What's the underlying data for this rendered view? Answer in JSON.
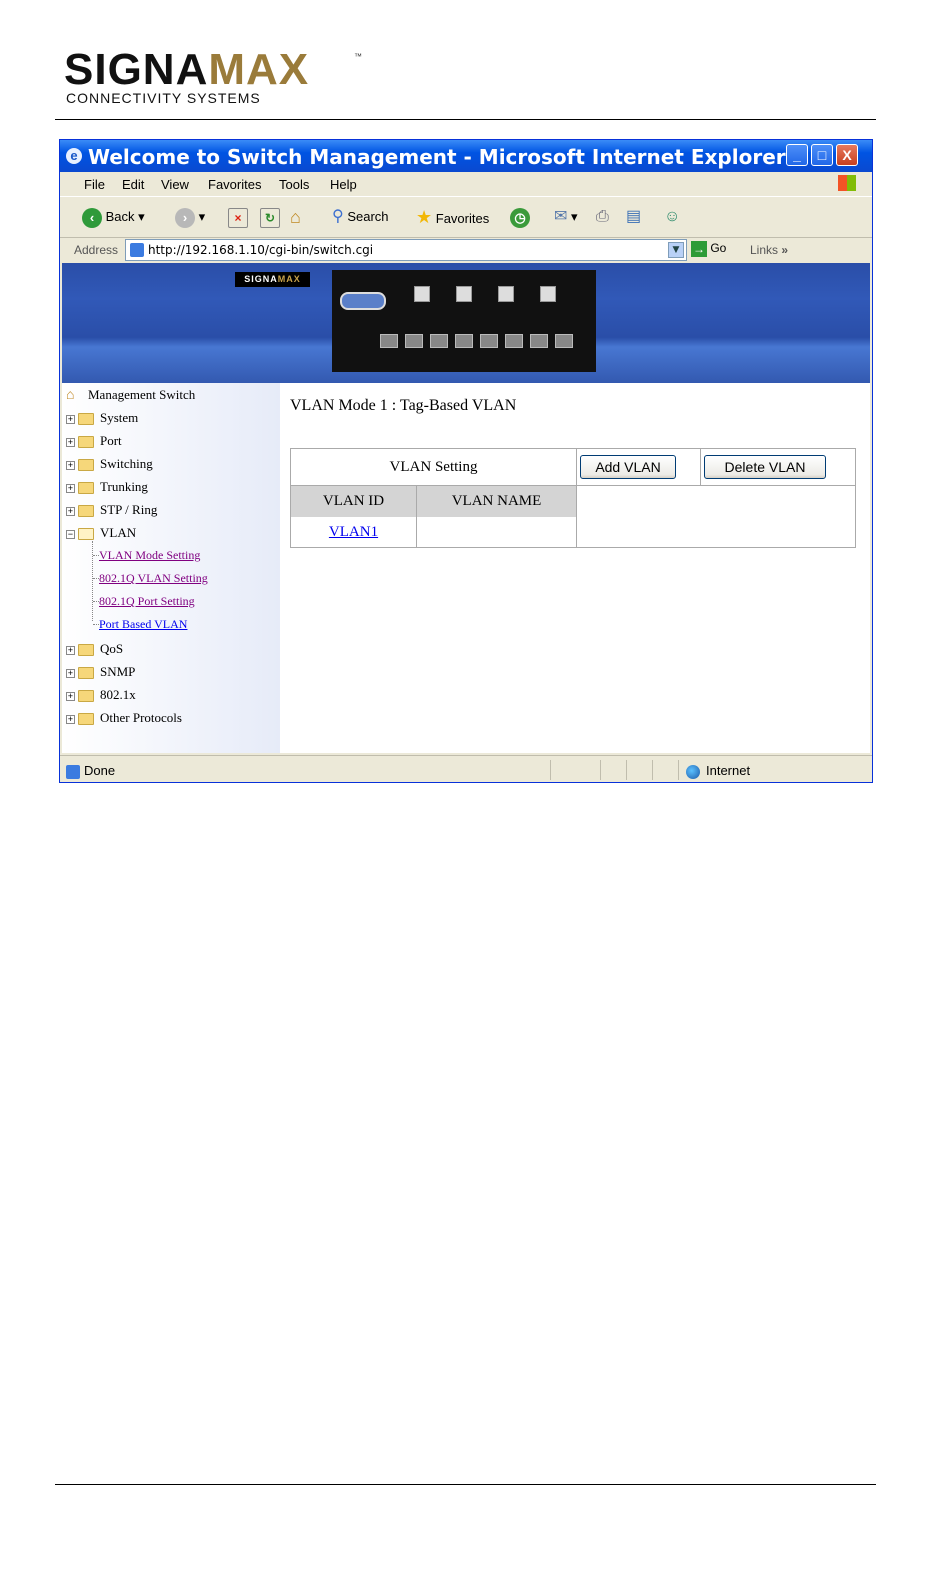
{
  "logo": {
    "brand_main": "SIGNA",
    "brand_accent": "MAX",
    "tm": "™",
    "tagline": "CONNECTIVITY SYSTEMS"
  },
  "window": {
    "title": "Welcome to Switch Management - Microsoft Internet Explorer",
    "title_icon": "ie-icon",
    "controls": {
      "minimize": "_",
      "maximize": "□",
      "close": "X"
    }
  },
  "menu": [
    "File",
    "Edit",
    "View",
    "Favorites",
    "Tools",
    "Help"
  ],
  "toolbar": {
    "back": "Back",
    "search": "Search",
    "favorites": "Favorites"
  },
  "address": {
    "label": "Address",
    "url": "http://192.168.1.10/cgi-bin/switch.cgi",
    "go": "Go",
    "links": "Links",
    "links_more": "»"
  },
  "banner": {
    "logo_main": "SIGNA",
    "logo_accent": "MAX"
  },
  "sidebar": {
    "root": "Management Switch",
    "items": [
      {
        "label": "System"
      },
      {
        "label": "Port"
      },
      {
        "label": "Switching"
      },
      {
        "label": "Trunking"
      },
      {
        "label": "STP / Ring"
      },
      {
        "label": "VLAN"
      },
      {
        "label": "QoS"
      },
      {
        "label": "SNMP"
      },
      {
        "label": "802.1x"
      },
      {
        "label": "Other Protocols"
      }
    ],
    "vlan_children": [
      {
        "label": "VLAN Mode Setting"
      },
      {
        "label": "802.1Q VLAN Setting"
      },
      {
        "label": "802.1Q Port Setting"
      },
      {
        "label": "Port Based VLAN"
      }
    ]
  },
  "main": {
    "mode_text": "VLAN Mode 1 : Tag-Based VLAN",
    "setting_label": "VLAN Setting",
    "add_button": "Add VLAN",
    "delete_button": "Delete VLAN",
    "columns": [
      "VLAN ID",
      "VLAN NAME"
    ],
    "rows": [
      {
        "id": "VLAN1",
        "name": ""
      }
    ]
  },
  "status": {
    "text": "Done",
    "zone": "Internet"
  },
  "colors": {
    "titlebar": "#0054e3",
    "brand_accent": "#9a7b3a",
    "link": "#0000ee",
    "visited_link": "#800080",
    "header_cell": "#d4d4d4"
  }
}
